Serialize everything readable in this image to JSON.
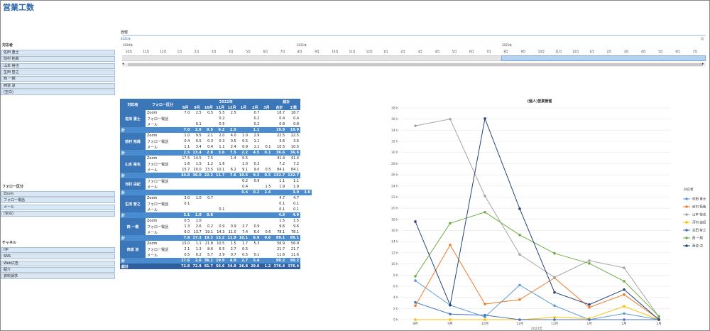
{
  "title": "営業工数",
  "slicers": {
    "responder": {
      "title": "対応者",
      "items": [
        "佐田 重士",
        "前村 拓哉",
        "山本 裕也",
        "生田 智之",
        "西 一樹",
        "西道 涼",
        "(空白)"
      ]
    },
    "followup": {
      "title": "フォロー区分",
      "items": [
        "Zoom",
        "フォロー電話",
        "メール",
        "(空白)"
      ]
    },
    "channel": {
      "title": "チャネル",
      "items": [
        "HP",
        "SNS",
        "Web広告",
        "紹介",
        "資料請求"
      ]
    }
  },
  "timeline": {
    "label": "日付",
    "range": "2021年",
    "unit": "月",
    "years": [
      "2020年",
      "2021年",
      "2022年"
    ],
    "months": [
      "10月",
      "11月",
      "12月",
      "1月",
      "2月",
      "3月",
      "4月",
      "5月",
      "6月",
      "7月",
      "8月",
      "9月",
      "10月",
      "11月",
      "12月",
      "1月",
      "2月",
      "3月",
      "4月",
      "5月",
      "6月",
      "7月",
      "8月",
      "9月",
      "10月",
      "11月",
      "12月",
      "1月",
      "2月",
      "3月",
      "4月",
      "5月",
      "6月",
      "7月"
    ]
  },
  "pivot": {
    "h_responder": "対応者",
    "h_followup": "フォロー区分",
    "h_year": "2022年",
    "h_total": "総計",
    "months": [
      "8月",
      "9月",
      "10月",
      "11月",
      "12月",
      "1月",
      "2月",
      "3月"
    ],
    "h_sum": "合計",
    "h_hours": "工数",
    "groups": [
      {
        "name": "佐田 重士",
        "rows": [
          [
            "Zoom",
            "7.0",
            "2.5",
            "0.5",
            "5.5",
            "2.5",
            "",
            "0.7",
            "",
            "18.7",
            "18.7"
          ],
          [
            "フォロー電話",
            "",
            "",
            "",
            "0.2",
            "",
            "",
            "0.2",
            "",
            "0.4",
            "0.4"
          ],
          [
            "メール",
            "",
            "0.1",
            "",
            "0.5",
            "",
            "",
            "0.2",
            "",
            "0.8",
            "0.8"
          ]
        ],
        "total": [
          "7.0",
          "2.6",
          "0.5",
          "6.2",
          "2.5",
          "",
          "1.1",
          "",
          "19.9",
          "19.9"
        ]
      },
      {
        "name": "前村 拓哉",
        "rows": [
          [
            "Zoom",
            "1.0",
            "9.5",
            "2.1",
            "2.0",
            "4.0",
            "1.0",
            "2.9",
            "",
            "22.5",
            "22.5"
          ],
          [
            "フォロー電話",
            "0.4",
            "0.5",
            "0.3",
            "0.3",
            "0.5",
            "0.5",
            "1.1",
            "",
            "3.6",
            "3.6"
          ],
          [
            "メール",
            "1.1",
            "3.4",
            "0.4",
            "1.1",
            "2.4",
            "0.9",
            "1.1",
            "0.1",
            "10.5",
            "10.5"
          ]
        ],
        "total": [
          "2.5",
          "13.4",
          "2.8",
          "3.6",
          "7.5",
          "2.2",
          "4.5",
          "0.1",
          "36.6",
          "36.6"
        ]
      },
      {
        "name": "山本 裕也",
        "rows": [
          [
            "Zoom",
            "17.5",
            "14.5",
            "7.5",
            "",
            "1.4",
            "0.5",
            "",
            "",
            "41.4",
            "41.4"
          ],
          [
            "フォロー電話",
            "1.6",
            "1.5",
            "1.2",
            "1.6",
            "",
            "1.0",
            "0.3",
            "",
            "7.2",
            "7.2"
          ],
          [
            "メール",
            "15.7",
            "20.0",
            "13.5",
            "10.1",
            "6.2",
            "9.1",
            "9.0",
            "0.5",
            "84.1",
            "84.1"
          ]
        ],
        "total": [
          "34.8",
          "36.0",
          "22.2",
          "11.7",
          "7.6",
          "10.6",
          "9.3",
          "0.5",
          "132.7",
          "132.7"
        ]
      },
      {
        "name": "河村 由紀",
        "rows": [
          [
            "フォロー電話",
            "",
            "",
            "",
            "",
            "",
            "0.2",
            "0.9",
            "",
            "1.1",
            "1.1"
          ],
          [
            "メール",
            "",
            "",
            "",
            "",
            "",
            "0.4",
            "",
            "1.5",
            "1.9",
            "1.9"
          ]
        ],
        "total": [
          "",
          "",
          "",
          "",
          "",
          "0.4",
          "0.2",
          "2.4",
          "",
          "3.0",
          "3.0"
        ]
      },
      {
        "name": "生田 智之",
        "rows": [
          [
            "Zoom",
            "3.0",
            "1.0",
            "0.7",
            "",
            "",
            "",
            "",
            "",
            "4.7",
            "4.7"
          ],
          [
            "フォロー電話",
            "0.1",
            "",
            "",
            "",
            "",
            "",
            "",
            "",
            "0.1",
            "0.1"
          ],
          [
            "メール",
            "",
            "",
            "",
            "0.1",
            "",
            "",
            "",
            "",
            "0.1",
            "0.1"
          ]
        ],
        "total": [
          "3.1",
          "1.0",
          "0.8",
          "",
          "",
          "",
          "",
          "",
          "4.9",
          "4.9"
        ]
      },
      {
        "name": "西 一樹",
        "rows": [
          [
            "Zoom",
            "0.5",
            "1.0",
            "",
            "",
            "",
            "",
            "",
            "",
            "1.5",
            "1.5"
          ],
          [
            "フォロー電話",
            "1.3",
            "2.6",
            "0.2",
            "0.9",
            "0.9",
            "2.7",
            "0.9",
            "",
            "9.6",
            "9.6"
          ],
          [
            "メール",
            "6.0",
            "13.7",
            "19.1",
            "14.3",
            "11.0",
            "7.4",
            "6.0",
            "0.6",
            "78.1",
            "78.1"
          ]
        ],
        "total": [
          "7.8",
          "17.3",
          "19.3",
          "15.2",
          "11.9",
          "10.1",
          "6.9",
          "0.6",
          "89.1",
          "89.1"
        ]
      },
      {
        "name": "西道 涼",
        "rows": [
          [
            "Zoom",
            "15.0",
            "1.1",
            "21.8",
            "10.5",
            "1.5",
            "1.7",
            "5.3",
            "",
            "56.9",
            "56.9"
          ],
          [
            "フォロー電話",
            "2.1",
            "1.3",
            "8.6",
            "6.5",
            "2.7",
            "0.5",
            "",
            "",
            "21.7",
            "21.7"
          ],
          [
            "メール",
            "0.5",
            "0.2",
            "5.7",
            "2.9",
            "0.7",
            "0.5",
            "0.1",
            "",
            "11.6",
            "11.6"
          ]
        ],
        "total": [
          "17.6",
          "2.6",
          "36.1",
          "19.9",
          "4.9",
          "2.7",
          "5.4",
          "",
          "90.2",
          "90.2"
        ]
      }
    ],
    "sub_label": "計",
    "grand": [
      "72.8",
      "72.9",
      "81.7",
      "56.6",
      "34.8",
      "26.8",
      "29.6",
      "1.2",
      "376.4",
      "376.4"
    ]
  },
  "chart_data": {
    "type": "line",
    "title": "(個人)営業管理",
    "xlabel": "2022年",
    "legend_title": "対応者",
    "categories": [
      "8月",
      "9月",
      "10月",
      "11月",
      "12月",
      "1月",
      "2月",
      "3月"
    ],
    "yticks": [
      "0 h",
      "2 h",
      "4 h",
      "6 h",
      "8 h",
      "10 h",
      "12 h",
      "14 h",
      "16 h",
      "18 h",
      "20 h",
      "22 h",
      "24 h",
      "26 h",
      "28 h",
      "30 h",
      "32 h",
      "34 h",
      "36 h",
      "38 h"
    ],
    "ylim": [
      0,
      38
    ],
    "series": [
      {
        "name": "佐田 重士",
        "color": "#5b9bd5",
        "values": [
          7.0,
          2.6,
          0.5,
          6.2,
          2.5,
          0,
          1.1,
          0
        ]
      },
      {
        "name": "前村 拓哉",
        "color": "#ed7d31",
        "values": [
          2.5,
          13.4,
          2.8,
          3.6,
          7.5,
          2.2,
          4.5,
          0.1
        ]
      },
      {
        "name": "山本 裕也",
        "color": "#a5a5a5",
        "values": [
          34.8,
          36.0,
          22.2,
          11.7,
          7.6,
          10.6,
          9.3,
          0.5
        ]
      },
      {
        "name": "河村 由紀",
        "color": "#ffc000",
        "values": [
          0,
          0,
          0,
          0,
          0.4,
          0.2,
          2.4,
          0
        ]
      },
      {
        "name": "生田 智之",
        "color": "#4472c4",
        "values": [
          3.1,
          1.0,
          0.8,
          0,
          0,
          0,
          0,
          0
        ]
      },
      {
        "name": "西 一樹",
        "color": "#70ad47",
        "values": [
          7.8,
          17.3,
          19.3,
          15.2,
          11.9,
          10.1,
          6.9,
          0.6
        ]
      },
      {
        "name": "西道 涼",
        "color": "#264478",
        "values": [
          17.6,
          2.6,
          36.1,
          19.9,
          4.9,
          2.7,
          5.4,
          0
        ]
      }
    ]
  }
}
